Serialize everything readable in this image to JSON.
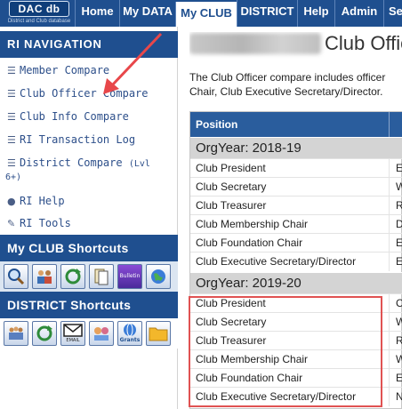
{
  "topnav": {
    "logo_text": "DAC db",
    "logo_subtext": "District and Club database",
    "tabs": [
      {
        "label": "Home"
      },
      {
        "label": "My DATA"
      },
      {
        "label": "My CLUB"
      },
      {
        "label": "DISTRICT"
      },
      {
        "label": "Help"
      },
      {
        "label": "Admin"
      },
      {
        "label": "Se"
      }
    ],
    "active_tab": "My CLUB"
  },
  "sidebar": {
    "ri_nav_header": "RI NAVIGATION",
    "items": [
      {
        "icon": "list-icon",
        "label": "Member Compare"
      },
      {
        "icon": "list-icon",
        "label": "Club Officer Compare"
      },
      {
        "icon": "list-icon",
        "label": "Club Info Compare"
      },
      {
        "icon": "list-icon",
        "label": "RI Transaction Log"
      },
      {
        "icon": "list-icon",
        "label": "District Compare",
        "suffix": "(Lvl",
        "suffix2": "6+)"
      },
      {
        "icon": "help-circle-icon",
        "label": "RI Help"
      },
      {
        "icon": "wrench-icon",
        "label": "RI Tools"
      }
    ],
    "club_shortcuts_header": "My CLUB Shortcuts",
    "club_shortcuts": [
      "magnify-icon",
      "people-icon",
      "refresh-arrow-icon",
      "document-icon",
      "bulletin-icon",
      "globe-icon"
    ],
    "district_shortcuts_header": "DISTRICT Shortcuts",
    "district_shortcuts": [
      "users-group-icon",
      "refresh-arrow-icon",
      "mail-icon",
      "avatars-icon",
      "grants-icon",
      "folder-icon"
    ],
    "bulletin_label": "Bulletin",
    "email_label": "EMAIL",
    "grants_label": "Grants"
  },
  "main": {
    "title": "Club Officer",
    "intro_line1": "The Club Officer compare includes officer",
    "intro_line2": "Chair, Club Executive Secretary/Director.",
    "table_header": "Position",
    "groups": [
      {
        "label": "OrgYear: 2018-19",
        "rows": [
          {
            "position": "Club President",
            "second": "E"
          },
          {
            "position": "Club Secretary",
            "second": "W"
          },
          {
            "position": "Club Treasurer",
            "second": "R"
          },
          {
            "position": "Club Membership Chair",
            "second": "D"
          },
          {
            "position": "Club Foundation Chair",
            "second": "E"
          },
          {
            "position": "Club Executive Secretary/Director",
            "second": "E"
          }
        ]
      },
      {
        "label": "OrgYear: 2019-20",
        "rows": [
          {
            "position": "Club President",
            "second": "C"
          },
          {
            "position": "Club Secretary",
            "second": "W"
          },
          {
            "position": "Club Treasurer",
            "second": "R"
          },
          {
            "position": "Club Membership Chair",
            "second": "W"
          },
          {
            "position": "Club Foundation Chair",
            "second": "E"
          },
          {
            "position": "Club Executive Secretary/Director",
            "second": "N"
          }
        ]
      }
    ]
  },
  "annotation": {
    "arrow_color": "#e8474a",
    "box_color": "#e05252"
  },
  "colors": {
    "nav_blue": "#1f4f8f",
    "table_header_blue": "#2a5d9d",
    "link_blue": "#2d4f8a"
  }
}
